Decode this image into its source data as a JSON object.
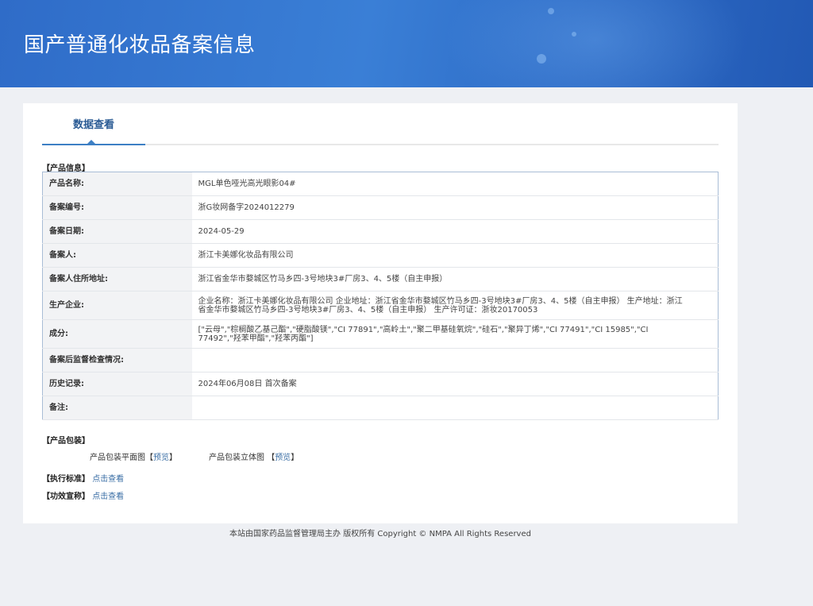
{
  "header": {
    "title": "国产普通化妆品备案信息"
  },
  "tabs": [
    {
      "label": "数据查看"
    }
  ],
  "product_info": {
    "section_title": "【产品信息】",
    "rows": [
      {
        "label": "产品名称:",
        "value": "MGL单色哑光高光眼影04#"
      },
      {
        "label": "备案编号:",
        "value": "浙G妆网备字2024012279"
      },
      {
        "label": "备案日期:",
        "value": "2024-05-29"
      },
      {
        "label": "备案人:",
        "value": "浙江卡美娜化妆品有限公司"
      },
      {
        "label": "备案人住所地址:",
        "value": "浙江省金华市婺城区竹马乡四-3号地块3#厂房3、4、5楼（自主申报）"
      },
      {
        "label": "生产企业:",
        "value": "企业名称：浙江卡美娜化妆品有限公司 企业地址：浙江省金华市婺城区竹马乡四-3号地块3#厂房3、4、5楼（自主申报） 生产地址：浙江省金华市婺城区竹马乡四-3号地块3#厂房3、4、5楼（自主申报） 生产许可证：浙妆20170053"
      },
      {
        "label": "成分:",
        "value": "[\"云母\",\"棕榈酸乙基己酯\",\"硬脂酸镁\",\"CI 77891\",\"高岭土\",\"聚二甲基硅氧烷\",\"硅石\",\"聚异丁烯\",\"CI 77491\",\"CI 15985\",\"CI 77492\",\"羟苯甲酯\",\"羟苯丙酯\"]"
      },
      {
        "label": "备案后监督检查情况:",
        "value": ""
      },
      {
        "label": "历史记录:",
        "value": "2024年06月08日 首次备案"
      },
      {
        "label": "备注:",
        "value": ""
      }
    ]
  },
  "packaging": {
    "section_title": "【产品包装】",
    "flat_label": "产品包装平面图",
    "solid_label": "产品包装立体图",
    "preview_link": "预览",
    "bracket_open": "【",
    "bracket_close": "】"
  },
  "standard": {
    "label": "【执行标准】",
    "link": "点击查看"
  },
  "efficacy": {
    "label": "【功效宣称】",
    "link": "点击查看"
  },
  "footer": {
    "text": "本站由国家药品监督管理局主办 版权所有 Copyright © NMPA All Rights Reserved"
  },
  "colors": {
    "banner": "#2f6cc8",
    "link": "#3a6ea5",
    "tab_accent": "#3d7fc4"
  }
}
